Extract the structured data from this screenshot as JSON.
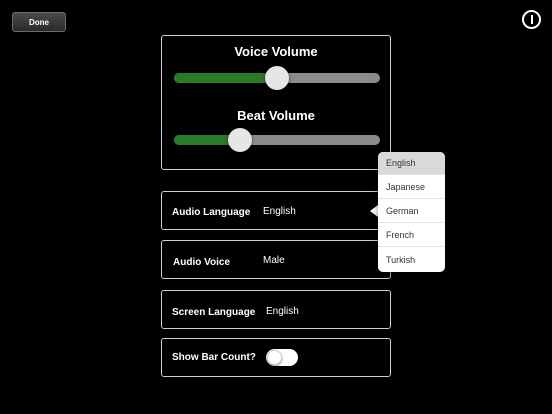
{
  "toolbar": {
    "done_label": "Done",
    "info_icon": "info-icon"
  },
  "volume": {
    "voice": {
      "label": "Voice Volume",
      "level_fraction": 0.5
    },
    "beat": {
      "label": "Beat Volume",
      "level_fraction": 0.32
    }
  },
  "settings": {
    "audio_language": {
      "label": "Audio Language",
      "value": "English"
    },
    "audio_voice": {
      "label": "Audio Voice",
      "value": "Male"
    },
    "screen_language": {
      "label": "Screen Language",
      "value": "English"
    },
    "show_bar_count": {
      "label": "Show Bar Count?",
      "enabled": false
    }
  },
  "language_dropdown": {
    "selected": "English",
    "options": [
      "English",
      "Japanese",
      "German",
      "French",
      "Turkish"
    ]
  },
  "colors": {
    "background": "#000000",
    "slider_fill": "#2a7a2a",
    "slider_track": "#8c8c8c",
    "panel_border": "#d0d0d0"
  }
}
